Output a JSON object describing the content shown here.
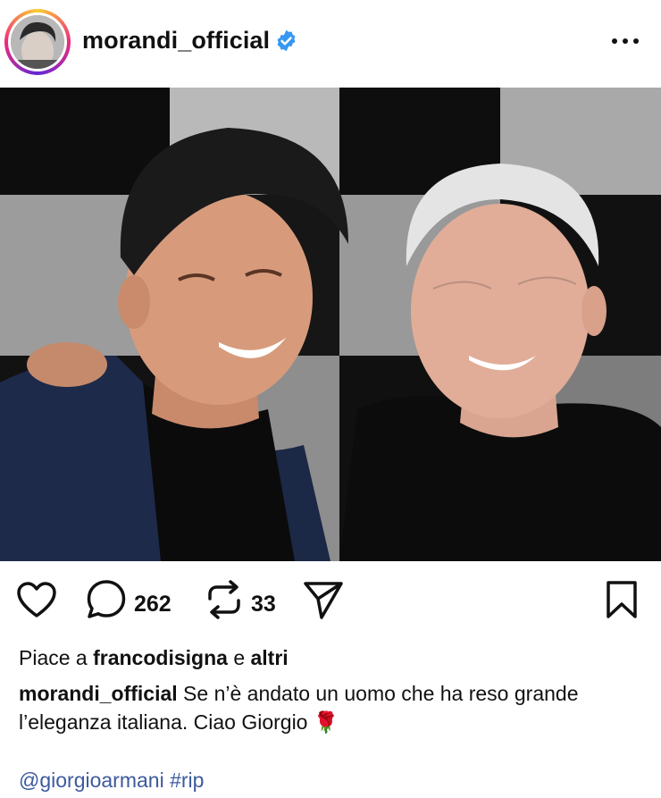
{
  "post": {
    "username": "morandi_official",
    "likes_prefix": "Piace a",
    "likes_user": "francodisigna",
    "likes_and": "e",
    "likes_others": "altri",
    "caption_user": "morandi_official",
    "caption_text": "Se n’è andato un uomo che ha reso grande l’eleganza italiana. Ciao Giorgio",
    "caption_emoji": "🌹",
    "mention": "@giorgioarmani",
    "hashtag": "#rip"
  },
  "actions": {
    "comments_count": "262",
    "reposts_count": "33"
  },
  "icons": {
    "verified": "verified-badge-icon",
    "more": "more-options-icon",
    "like": "heart-icon",
    "comment": "comment-icon",
    "repost": "repost-icon",
    "share": "send-icon",
    "save": "bookmark-icon"
  },
  "colors": {
    "verified_blue": "#3897f0",
    "link_blue": "#3d5a9e"
  }
}
